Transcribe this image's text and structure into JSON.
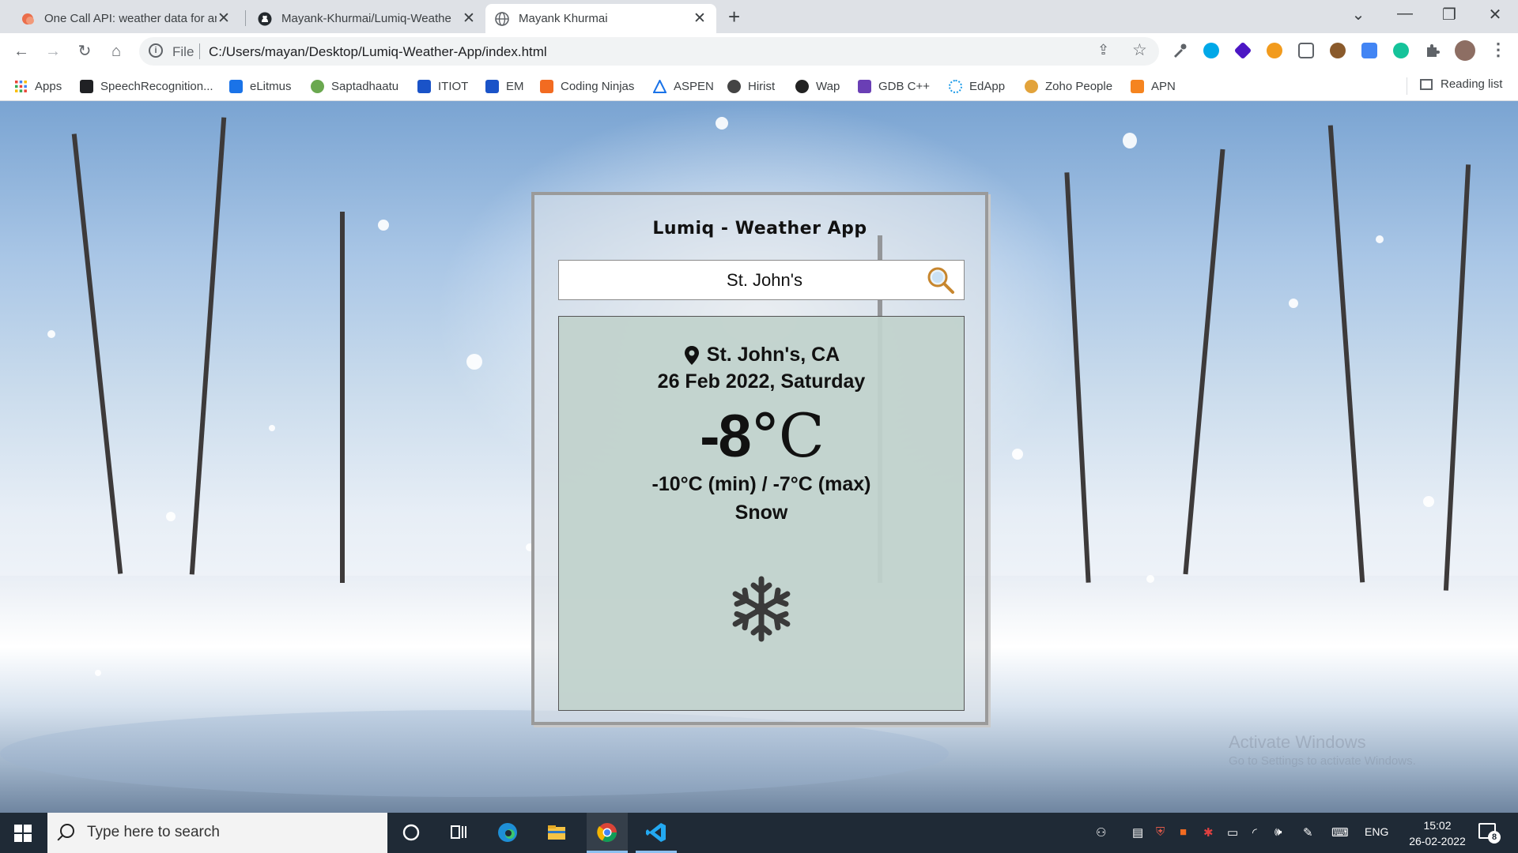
{
  "browser": {
    "tabs": [
      {
        "title": "One Call API: weather data for an",
        "favicon": "openweather-icon",
        "active": false
      },
      {
        "title": "Mayank-Khurmai/Lumiq-Weathe",
        "favicon": "github-icon",
        "active": false
      },
      {
        "title": "Mayank Khurmai",
        "favicon": "globe-icon",
        "active": true
      }
    ],
    "address_scheme": "File",
    "address_url": "C:/Users/mayan/Desktop/Lumiq-Weather-App/index.html",
    "bookmarks": [
      {
        "label": "Apps",
        "color": "#4285f4"
      },
      {
        "label": "SpeechRecognition...",
        "color": "#202124"
      },
      {
        "label": "eLitmus",
        "color": "#1a73e8"
      },
      {
        "label": "Saptadhaatu",
        "color": "#6aa84f"
      },
      {
        "label": "ITIOT",
        "color": "#1a53c8"
      },
      {
        "label": "EM",
        "color": "#1a53c8"
      },
      {
        "label": "Coding Ninjas",
        "color": "#f26b21"
      },
      {
        "label": "ASPEN",
        "color": "#1a73e8"
      },
      {
        "label": "Hirist",
        "color": "#444"
      },
      {
        "label": "Wap",
        "color": "#222"
      },
      {
        "label": "GDB C++",
        "color": "#6a3fb5"
      },
      {
        "label": "EdApp",
        "color": "#1a9ae8"
      },
      {
        "label": "Zoho People",
        "color": "#e2a33b"
      },
      {
        "label": "APN",
        "color": "#f5841f"
      }
    ],
    "reading_list": "Reading list"
  },
  "app": {
    "title": "Lumiq - Weather App",
    "search_value": "St. John's",
    "location": "St. John's, CA",
    "date": "26 Feb 2022, Saturday",
    "temp_value": "-8",
    "temp_unit": "°C",
    "min_max": "-10°C (min) / -7°C (max)",
    "condition": "Snow",
    "condition_icon": "snowflake-icon"
  },
  "watermark": {
    "line1": "Activate Windows",
    "line2": "Go to Settings to activate Windows."
  },
  "taskbar": {
    "search_placeholder": "Type here to search",
    "language": "ENG",
    "time": "15:02",
    "date": "26-02-2022",
    "notifications": "8"
  }
}
